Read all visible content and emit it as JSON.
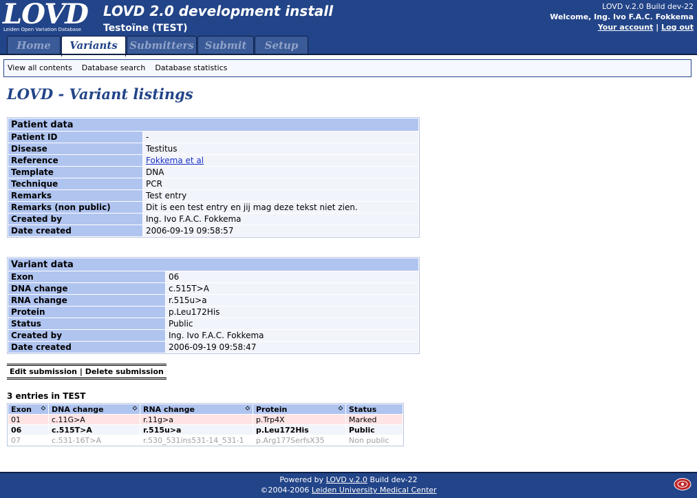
{
  "header": {
    "logo_text": "LOVD",
    "logo_subtitle": "Leiden Open Variation Database",
    "site_title": "LOVD 2.0 development install",
    "gene_title": "Testoïne (TEST)",
    "build": "LOVD v.2.0 Build dev-22",
    "welcome": "Welcome, Ing. Ivo F.A.C. Fokkema",
    "your_account": "Your account",
    "separator": "|",
    "log_out": "Log out"
  },
  "tabs": [
    {
      "label": "Home"
    },
    {
      "label": "Variants"
    },
    {
      "label": "Submitters"
    },
    {
      "label": "Submit"
    },
    {
      "label": "Setup"
    }
  ],
  "subnav": [
    "View all contents",
    "Database search",
    "Database statistics"
  ],
  "page_title": "LOVD - Variant listings",
  "patient": {
    "title": "Patient data",
    "rows": [
      {
        "label": "Patient ID",
        "value": "-"
      },
      {
        "label": "Disease",
        "value": "Testitus"
      },
      {
        "label": "Reference",
        "value": "Fokkema et al"
      },
      {
        "label": "Template",
        "value": "DNA"
      },
      {
        "label": "Technique",
        "value": "PCR"
      },
      {
        "label": "Remarks",
        "value": "Test entry"
      },
      {
        "label": "Remarks (non public)",
        "value": "Dit is een test entry en jij mag deze tekst niet zien."
      },
      {
        "label": "Created by",
        "value": "Ing. Ivo F.A.C. Fokkema"
      },
      {
        "label": "Date created",
        "value": "2006-09-19 09:58:57"
      }
    ]
  },
  "variant": {
    "title": "Variant data",
    "rows": [
      {
        "label": "Exon",
        "value": "06"
      },
      {
        "label": "DNA change",
        "value": "c.515T>A"
      },
      {
        "label": "RNA change",
        "value": "r.515u>a"
      },
      {
        "label": "Protein",
        "value": "p.Leu172His"
      },
      {
        "label": "Status",
        "value": "Public"
      },
      {
        "label": "Created by",
        "value": "Ing. Ivo F.A.C. Fokkema"
      },
      {
        "label": "Date created",
        "value": "2006-09-19 09:58:47"
      }
    ]
  },
  "actions": {
    "edit": "Edit submission",
    "separator": "|",
    "delete": "Delete submission"
  },
  "listing": {
    "count_text": "3 entries in TEST",
    "columns": [
      "Exon",
      "DNA change",
      "RNA change",
      "Protein",
      "Status"
    ],
    "rows": [
      {
        "exon": "01",
        "dna": "c.11G>A",
        "rna": "r.11g>a",
        "protein": "p.Trp4X",
        "status": "Marked"
      },
      {
        "exon": "06",
        "dna": "c.515T>A",
        "rna": "r.515u>a",
        "protein": "p.Leu172His",
        "status": "Public"
      },
      {
        "exon": "07",
        "dna": "c.531-16T>A",
        "rna": "r.530_531ins531-14_531-1",
        "protein": "p.Arg177SerfsX35",
        "status": "Non public"
      }
    ]
  },
  "footer": {
    "powered_prefix": "Powered by",
    "powered_link": "LOVD v.2.0",
    "powered_suffix": "Build dev-22",
    "copyright_prefix": "©2004-2006",
    "copyright_link": "Leiden University Medical Center"
  },
  "colors": {
    "header_bg": "#224488",
    "label_bg": "#b0c4f0",
    "value_bg": "#f2f4fb",
    "marked_bg": "#ffe4e4"
  }
}
